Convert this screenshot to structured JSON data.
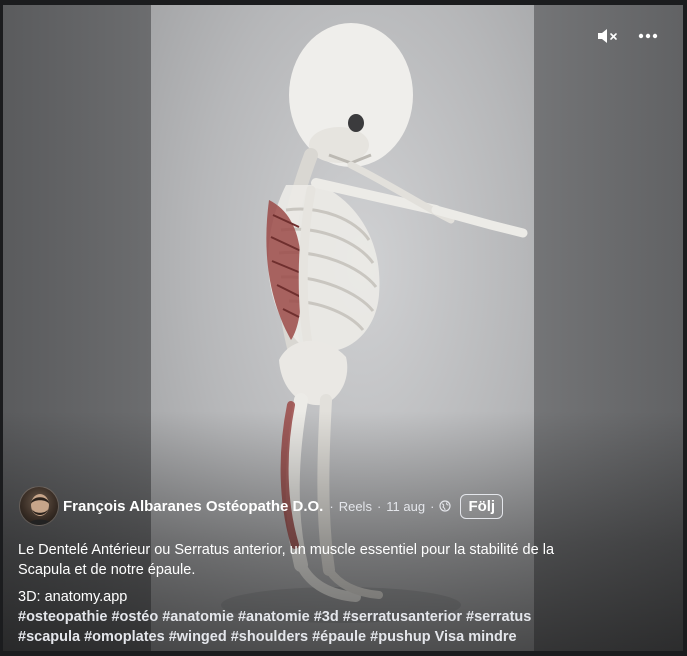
{
  "controls": {
    "mute_icon": "speaker-muted-icon",
    "more_icon": "more-horizontal-icon"
  },
  "author": {
    "name": "François Albaranes Ostéopathe D.O.",
    "avatar_icon": "profile-avatar"
  },
  "meta": {
    "sep1": "·",
    "source": "Reels",
    "sep2": "·",
    "date": "11 aug",
    "sep3": "·",
    "privacy_icon": "globe-icon"
  },
  "follow_label": "Följ",
  "caption": {
    "line1": "Le Dentelé Antérieur ou Serratus anterior, un muscle essentiel pour la stabilité de la Scapula et de notre épaule.",
    "credit": "3D: anatomy.app",
    "hashtags": "#osteopathie #ostéo #anatomie #anatomie #3d #serratusanterior #serratus #scapula #omoplates #winged #shoulders #épaule #pushup",
    "see_more": "Visa mindre"
  },
  "colors": {
    "page_bg": "#1b1c1e",
    "muscle": "#9b4a48",
    "bone": "#eceae6"
  }
}
